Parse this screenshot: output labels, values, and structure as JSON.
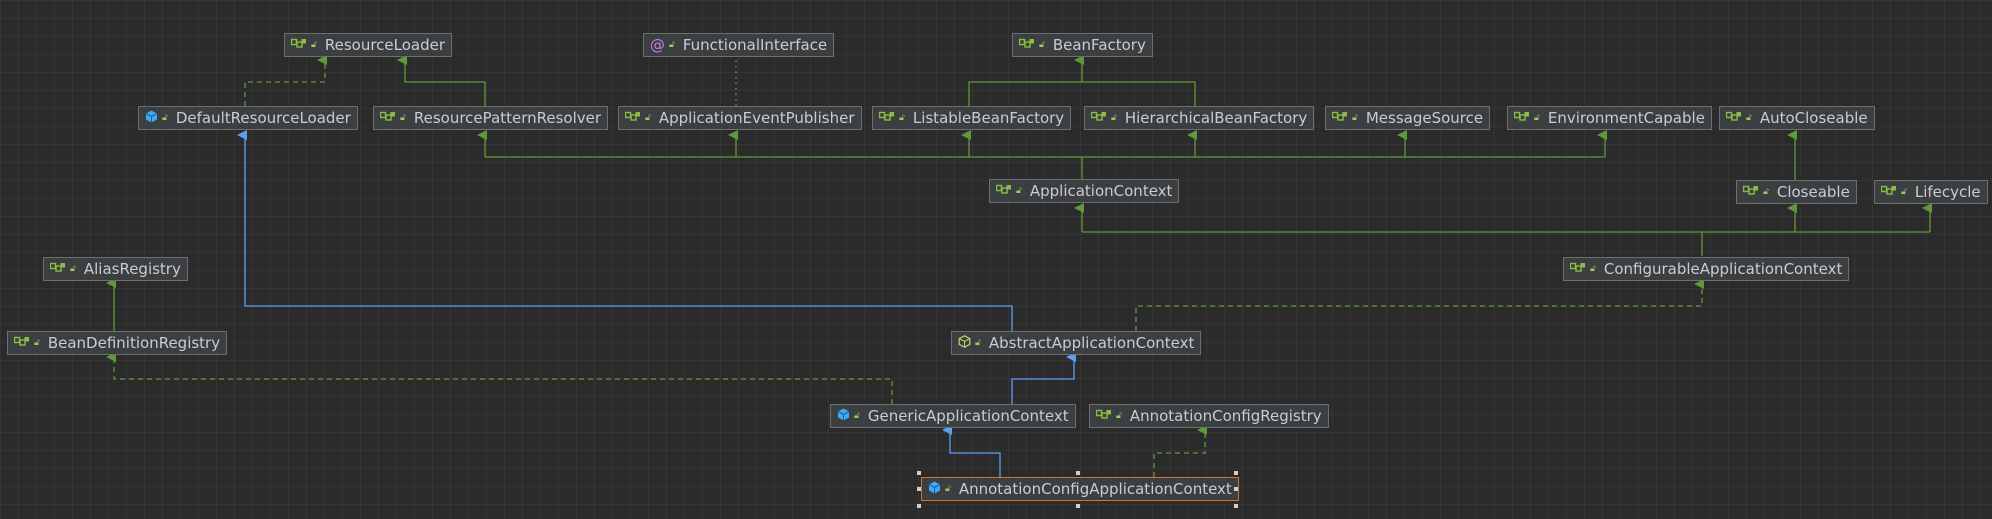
{
  "colors": {
    "interface_icon": "#8cbf3f",
    "class_icon": "#3fa9f5",
    "annotation_icon": "#c37fe3",
    "extends_edge": "#5aa0f5",
    "implements_edge": "#5f9a3a",
    "selected_border": "#d7732c"
  },
  "nodes": {
    "resource_loader": {
      "label": "ResourceLoader",
      "kind": "interface",
      "icon": "interface-icon"
    },
    "functional_interface": {
      "label": "FunctionalInterface",
      "kind": "annotation",
      "icon": "annotation-icon"
    },
    "bean_factory": {
      "label": "BeanFactory",
      "kind": "interface",
      "icon": "interface-icon"
    },
    "default_resource_loader": {
      "label": "DefaultResourceLoader",
      "kind": "class",
      "icon": "class-icon"
    },
    "resource_pattern_resolver": {
      "label": "ResourcePatternResolver",
      "kind": "interface",
      "icon": "interface-icon"
    },
    "application_event_publisher": {
      "label": "ApplicationEventPublisher",
      "kind": "interface",
      "icon": "interface-icon"
    },
    "listable_bean_factory": {
      "label": "ListableBeanFactory",
      "kind": "interface",
      "icon": "interface-icon"
    },
    "hierarchical_bean_factory": {
      "label": "HierarchicalBeanFactory",
      "kind": "interface",
      "icon": "interface-icon"
    },
    "message_source": {
      "label": "MessageSource",
      "kind": "interface",
      "icon": "interface-icon"
    },
    "environment_capable": {
      "label": "EnvironmentCapable",
      "kind": "interface",
      "icon": "interface-icon"
    },
    "auto_closeable": {
      "label": "AutoCloseable",
      "kind": "interface",
      "icon": "interface-icon"
    },
    "application_context": {
      "label": "ApplicationContext",
      "kind": "interface",
      "icon": "interface-icon"
    },
    "closeable": {
      "label": "Closeable",
      "kind": "interface",
      "icon": "interface-icon"
    },
    "lifecycle": {
      "label": "Lifecycle",
      "kind": "interface",
      "icon": "interface-icon"
    },
    "alias_registry": {
      "label": "AliasRegistry",
      "kind": "interface",
      "icon": "interface-icon"
    },
    "configurable_application_context": {
      "label": "ConfigurableApplicationContext",
      "kind": "interface",
      "icon": "interface-icon"
    },
    "bean_definition_registry": {
      "label": "BeanDefinitionRegistry",
      "kind": "interface",
      "icon": "interface-icon"
    },
    "abstract_application_context": {
      "label": "AbstractApplicationContext",
      "kind": "abstract",
      "icon": "abstract-class-icon"
    },
    "generic_application_context": {
      "label": "GenericApplicationContext",
      "kind": "class",
      "icon": "class-icon"
    },
    "annotation_config_registry": {
      "label": "AnnotationConfigRegistry",
      "kind": "interface",
      "icon": "interface-icon"
    },
    "annotation_config_application_context": {
      "label": "AnnotationConfigApplicationContext",
      "kind": "class",
      "icon": "class-icon",
      "selected": true
    }
  }
}
